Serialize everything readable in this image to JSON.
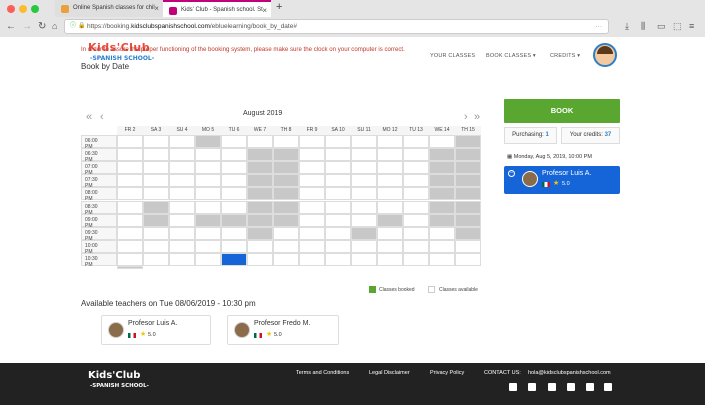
{
  "browser": {
    "tabs": [
      {
        "title": "Online Spanish classes for chil",
        "active": false
      },
      {
        "title": "Kids' Club - Spanish school. St",
        "active": true
      }
    ],
    "new_tab": "+",
    "url_prefix": "https://booking.",
    "url_domain": "kidsclubspanishschool.com",
    "url_path": "/ebluelearning/book_by_date#"
  },
  "site": {
    "logo_top": "Kids'Club",
    "logo_bottom": "-SPANISH SCHOOL-",
    "nav": {
      "your_classes": "YOUR CLASSES",
      "book_classes": "BOOK CLASSES",
      "credits": "CREDITS"
    },
    "warning": "In order to assure the proper functioning of the booking system, please make sure the clock on your computer is correct.",
    "section_title": "Book by Date",
    "month": "August 2019",
    "days": [
      "FR 2",
      "SA 3",
      "SU 4",
      "MO 5",
      "TU 6",
      "WE 7",
      "TH 8",
      "FR 9",
      "SA 10",
      "SU 11",
      "MO 12",
      "TU 13",
      "WE 14",
      "TH 15"
    ],
    "times": [
      "06:00 PM",
      "06:30 PM",
      "07:00 PM",
      "07:30 PM",
      "08:00 PM",
      "08:30 PM",
      "09:00 PM",
      "09:30 PM",
      "10:00 PM",
      "10:30 PM"
    ],
    "legend": {
      "booked": "Classes booked",
      "available": "Classes available"
    },
    "available_title": "Available teachers on Tue 08/06/2019 - 10:30 pm",
    "teachers": [
      {
        "name": "Profesor Luis A.",
        "rating": "5.0"
      },
      {
        "name": "Profesor Fredo M.",
        "rating": "5.0"
      }
    ],
    "sidebar": {
      "book_label": "BOOK",
      "purchasing_label": "Purchasing:",
      "purchasing_value": "1",
      "credits_label": "Your credits:",
      "credits_value": "37",
      "selected_date": "Monday, Aug 5, 2019, 10:00 PM",
      "selected_teacher": "Profesor Luis A.",
      "selected_rating": "5.0"
    },
    "footer": {
      "logo_top": "Kids'Club",
      "logo_bottom": "-SPANISH SCHOOL-",
      "terms": "Terms and Conditions",
      "legal": "Legal Disclaimer",
      "privacy": "Privacy Policy",
      "contact": "CONTACT US:",
      "email": "hola@kidsclubspanishschool.com"
    },
    "colors": {
      "booked": "#c8c8c8",
      "selected": "#1565d8",
      "book_button": "#59a630",
      "legend_booked": "#59a630"
    }
  }
}
